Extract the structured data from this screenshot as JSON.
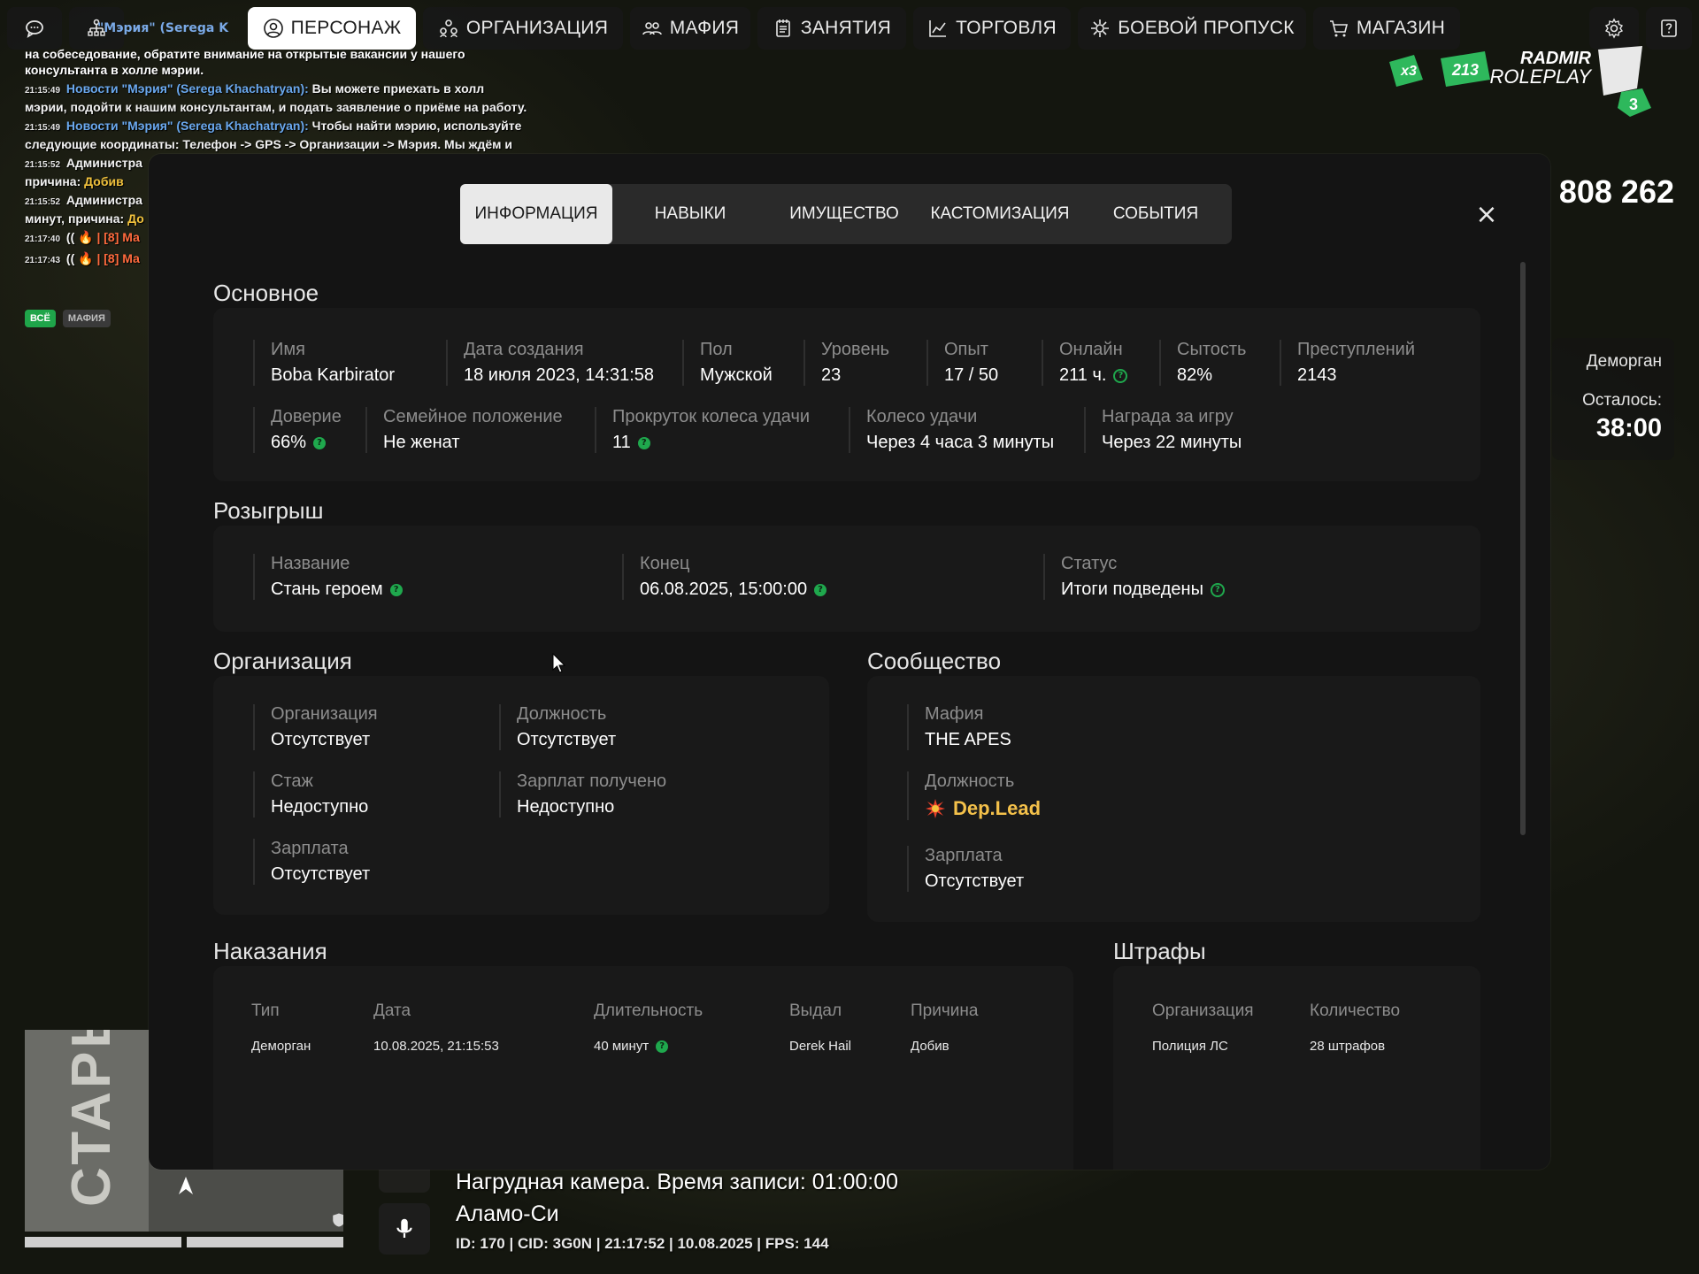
{
  "nav": {
    "character": "ПЕРСОНАЖ",
    "organization": "ОРГАНИЗАЦИЯ",
    "mafia": "МАФИЯ",
    "activities": "ЗАНЯТИЯ",
    "trade": "ТОРГОВЛЯ",
    "battlepass": "БОЕВОЙ ПРОПУСК",
    "shop": "МАГАЗИН"
  },
  "chat": {
    "top_partial": "\"Мэрия\" (Serega K",
    "lines": [
      {
        "ts": "",
        "pre": "",
        "body": "на собеседование, обратите внимание на открытые вакансии у нашего консультанта в холле мэрии."
      },
      {
        "ts": "21:15:49",
        "pre": "Новости \"Мэрия\" (Serega Khachatryan):",
        "body": "Вы можете приехать в холл мэрии, подойти к нашим консультантам, и подать заявление о приёме на работу."
      },
      {
        "ts": "21:15:49",
        "pre": "Новости \"Мэрия\" (Serega Khachatryan):",
        "body": "Чтобы найти мэрию, используйте следующие координаты: Телефон -> GPS -> Организации -> Мэрия. Мы ждём и"
      },
      {
        "ts": "21:15:52",
        "pre": "Администра",
        "body": "причина:",
        "tail": "Добив"
      },
      {
        "ts": "21:15:52",
        "pre": "Администра",
        "body": "минут, причина:",
        "tail": "До"
      },
      {
        "ts": "21:17:40",
        "pre": "((",
        "body": "🔥 | [8] Ма"
      },
      {
        "ts": "21:17:43",
        "pre": "((",
        "body": "🔥 | [8] Ма"
      }
    ],
    "filter_all": "ВСЁ",
    "filter_mafia": "МАФИЯ"
  },
  "hud": {
    "x_mult": "x3",
    "online_count": "213",
    "brand_top": "RADMIR",
    "brand_bottom": "ROLEPLAY",
    "server_num": "3",
    "money": "808 262",
    "jail_label": "Деморган",
    "remaining_label": "Осталось:",
    "remaining_time": "38:00"
  },
  "bottom": {
    "map_label": "СТАРЫ",
    "bodycam": "Нагрудная камера. Время записи: 01:00:00",
    "location": "Аламо-Си",
    "status": "ID: 170 | CID: 3G0N | 21:17:52  | 10.08.2025 | FPS: 144"
  },
  "modal": {
    "tabs": [
      "ИНФОРМАЦИЯ",
      "НАВЫКИ",
      "ИМУЩЕСТВО",
      "КАСТОМИЗАЦИЯ",
      "СОБЫТИЯ"
    ],
    "close": "×",
    "basic": {
      "title": "Основное",
      "name_l": "Имя",
      "name_v": "Boba Karbirator",
      "created_l": "Дата создания",
      "created_v": "18 июля 2023, 14:31:58",
      "sex_l": "Пол",
      "sex_v": "Мужской",
      "level_l": "Уровень",
      "level_v": "23",
      "exp_l": "Опыт",
      "exp_v": "17 / 50",
      "online_l": "Онлайн",
      "online_v": "211 ч.",
      "satiety_l": "Сытость",
      "satiety_v": "82%",
      "crimes_l": "Преступлений",
      "crimes_v": "2143",
      "trust_l": "Доверие",
      "trust_v": "66%",
      "family_l": "Семейное положение",
      "family_v": "Не женат",
      "spins_l": "Прокруток колеса удачи",
      "spins_v": "11",
      "wheel_l": "Колесо удачи",
      "wheel_v": "Через 4 часа 3 минуты",
      "reward_l": "Награда за игру",
      "reward_v": "Через 22 минуты"
    },
    "raffle": {
      "title": "Розыгрыш",
      "name_l": "Название",
      "name_v": "Стань героем",
      "end_l": "Конец",
      "end_v": "06.08.2025, 15:00:00",
      "status_l": "Статус",
      "status_v": "Итоги подведены"
    },
    "org": {
      "title": "Организация",
      "org_l": "Организация",
      "org_v": "Отсутствует",
      "pos_l": "Должность",
      "pos_v": "Отсутствует",
      "exp_l": "Стаж",
      "exp_v": "Недоступно",
      "paid_l": "Зарплат получено",
      "paid_v": "Недоступно",
      "salary_l": "Зарплата",
      "salary_v": "Отсутствует"
    },
    "community": {
      "title": "Сообщество",
      "mafia_l": "Мафия",
      "mafia_v": "THE APES",
      "pos_l": "Должность",
      "pos_v": "Dep.Lead",
      "salary_l": "Зарплата",
      "salary_v": "Отсутствует"
    },
    "punish": {
      "title": "Наказания",
      "headers": [
        "Тип",
        "Дата",
        "Длительность",
        "Выдал",
        "Причина"
      ],
      "row": [
        "Деморган",
        "10.08.2025, 21:15:53",
        "40 минут",
        "Derek Hail",
        "Добив"
      ]
    },
    "fines": {
      "title": "Штрафы",
      "headers": [
        "Организация",
        "Количество"
      ],
      "row": [
        "Полиция ЛС",
        "28 штрафов"
      ]
    }
  },
  "colors": {
    "accent_green": "#1fa84d",
    "role_gold": "#f3c04a",
    "news_blue": "#6aa8ee"
  }
}
